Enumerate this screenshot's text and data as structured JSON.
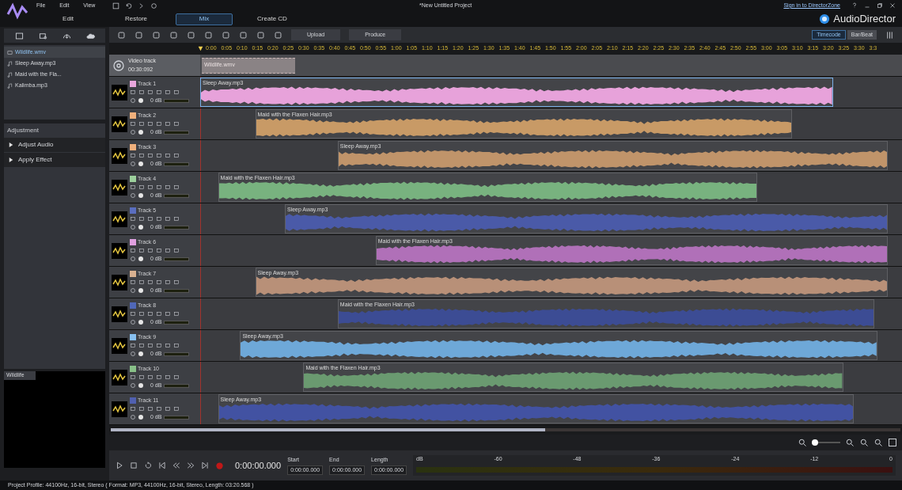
{
  "menu": [
    "File",
    "Edit",
    "View"
  ],
  "window": {
    "title": "*New Untitled Project",
    "sign_in": "Sign in to DirectorZone",
    "brand": "AudioDirector"
  },
  "tabs": [
    {
      "label": "Edit",
      "selected": false
    },
    {
      "label": "Restore",
      "selected": false
    },
    {
      "label": "Mix",
      "selected": true
    },
    {
      "label": "Create CD",
      "selected": false
    }
  ],
  "library": [
    {
      "name": "Wildlife.wmv",
      "kind": "video",
      "selected": true
    },
    {
      "name": "Sleep Away.mp3",
      "kind": "audio",
      "selected": false
    },
    {
      "name": "Maid with the Fla...",
      "kind": "audio",
      "selected": false
    },
    {
      "name": "Kalimba.mp3",
      "kind": "audio",
      "selected": false
    }
  ],
  "adjustment": {
    "title": "Adjustment",
    "items": [
      "Adjust Audio",
      "Apply Effect"
    ]
  },
  "preview": {
    "label": "Wildlife"
  },
  "toolbar": {
    "upload": "Upload",
    "produce": "Produce",
    "time_modes": [
      {
        "label": "Timecode",
        "selected": true
      },
      {
        "label": "Bar/Beat",
        "selected": false
      }
    ]
  },
  "ruler": [
    "0:00",
    "0:05",
    "0:10",
    "0:15",
    "0:20",
    "0:25",
    "0:30",
    "0:35",
    "0:40",
    "0:45",
    "0:50",
    "0:55",
    "1:00",
    "1:05",
    "1:10",
    "1:15",
    "1:20",
    "1:25",
    "1:30",
    "1:35",
    "1:40",
    "1:45",
    "1:50",
    "1:55",
    "2:00",
    "2:05",
    "2:10",
    "2:15",
    "2:20",
    "2:25",
    "2:30",
    "2:35",
    "2:40",
    "2:45",
    "2:50",
    "2:55",
    "3:00",
    "3:05",
    "3:10",
    "3:15",
    "3:20",
    "3:25",
    "3:30",
    "3:3"
  ],
  "video_track": {
    "name": "Video track",
    "duration": "00:30:092",
    "clip": "Wildlife.wmv"
  },
  "tracks": [
    {
      "name": "Track 1",
      "volume": "0 dB",
      "color": "#e8a6dc",
      "clip": {
        "name": "Sleep Away.mp3",
        "color": "#e7a2da",
        "selected": true
      }
    },
    {
      "name": "Track 2",
      "volume": "0 dB",
      "color": "#f0b07c",
      "clip": {
        "name": "Maid with the Flaxen Hair.mp3",
        "color": "#c89a66",
        "selected": false
      }
    },
    {
      "name": "Track 3",
      "volume": "0 dB",
      "color": "#f0b07c",
      "clip": {
        "name": "Sleep Away.mp3",
        "color": "#c0946a",
        "selected": false
      }
    },
    {
      "name": "Track 4",
      "volume": "0 dB",
      "color": "#9ccf9c",
      "clip": {
        "name": "Maid with the Flaxen Hair.mp3",
        "color": "#78b27f",
        "selected": false
      }
    },
    {
      "name": "Track 5",
      "volume": "0 dB",
      "color": "#5a6ec0",
      "clip": {
        "name": "Sleep Away.mp3",
        "color": "#4a5aa8",
        "selected": false
      }
    },
    {
      "name": "Track 6",
      "volume": "0 dB",
      "color": "#e0a0e0",
      "clip": {
        "name": "Maid with the Flaxen Hair.mp3",
        "color": "#b070b8",
        "selected": false
      }
    },
    {
      "name": "Track 7",
      "volume": "0 dB",
      "color": "#d8b090",
      "clip": {
        "name": "Sleep Away.mp3",
        "color": "#b89078",
        "selected": false
      }
    },
    {
      "name": "Track 8",
      "volume": "0 dB",
      "color": "#5068b8",
      "clip": {
        "name": "Maid with the Flaxen Hair.mp3",
        "color": "#3c4c94",
        "selected": false
      }
    },
    {
      "name": "Track 9",
      "volume": "0 dB",
      "color": "#88c0f0",
      "clip": {
        "name": "Sleep Away.mp3",
        "color": "#6ea8d8",
        "selected": false
      }
    },
    {
      "name": "Track 10",
      "volume": "0 dB",
      "color": "#88c088",
      "clip": {
        "name": "Maid with the Flaxen Hair.mp3",
        "color": "#6a9a70",
        "selected": false
      }
    },
    {
      "name": "Track 11",
      "volume": "0 dB",
      "color": "#5060b0",
      "clip": {
        "name": "Sleep Away.mp3",
        "color": "#4252a2",
        "selected": false
      }
    }
  ],
  "zoom": {
    "level": 0.1
  },
  "transport": {
    "time": "0:00:00.000",
    "start": {
      "label": "Start",
      "value": "0:00:00.000"
    },
    "end": {
      "label": "End",
      "value": "0:00:00.000"
    },
    "length": {
      "label": "Length",
      "value": "0:00:00.000"
    }
  },
  "meter": {
    "unit": "dB",
    "ticks": [
      "-60",
      "-48",
      "-36",
      "-24",
      "-12",
      "0"
    ]
  },
  "status_bar": "Project Profile: 44100Hz, 16-bit, Stereo ( Format: MP3, 44100Hz, 16-bit, Stereo, Length: 03:20.568 )"
}
